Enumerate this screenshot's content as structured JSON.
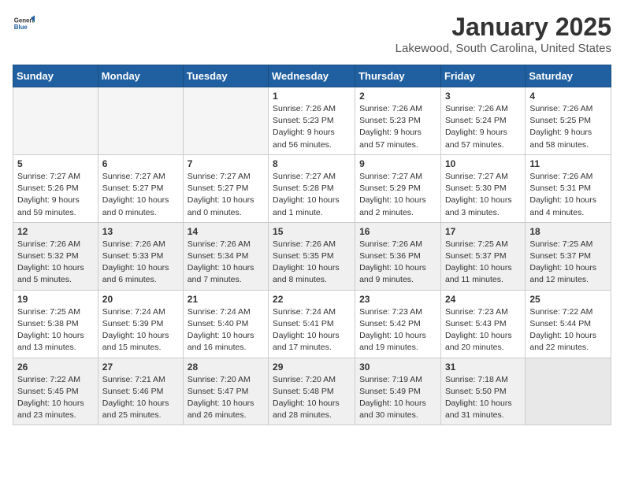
{
  "logo": {
    "general": "General",
    "blue": "Blue"
  },
  "header": {
    "title": "January 2025",
    "subtitle": "Lakewood, South Carolina, United States"
  },
  "weekdays": [
    "Sunday",
    "Monday",
    "Tuesday",
    "Wednesday",
    "Thursday",
    "Friday",
    "Saturday"
  ],
  "weeks": [
    {
      "shaded": false,
      "days": [
        {
          "num": "",
          "info": ""
        },
        {
          "num": "",
          "info": ""
        },
        {
          "num": "",
          "info": ""
        },
        {
          "num": "1",
          "info": "Sunrise: 7:26 AM\nSunset: 5:23 PM\nDaylight: 9 hours\nand 56 minutes."
        },
        {
          "num": "2",
          "info": "Sunrise: 7:26 AM\nSunset: 5:23 PM\nDaylight: 9 hours\nand 57 minutes."
        },
        {
          "num": "3",
          "info": "Sunrise: 7:26 AM\nSunset: 5:24 PM\nDaylight: 9 hours\nand 57 minutes."
        },
        {
          "num": "4",
          "info": "Sunrise: 7:26 AM\nSunset: 5:25 PM\nDaylight: 9 hours\nand 58 minutes."
        }
      ]
    },
    {
      "shaded": false,
      "days": [
        {
          "num": "5",
          "info": "Sunrise: 7:27 AM\nSunset: 5:26 PM\nDaylight: 9 hours\nand 59 minutes."
        },
        {
          "num": "6",
          "info": "Sunrise: 7:27 AM\nSunset: 5:27 PM\nDaylight: 10 hours\nand 0 minutes."
        },
        {
          "num": "7",
          "info": "Sunrise: 7:27 AM\nSunset: 5:27 PM\nDaylight: 10 hours\nand 0 minutes."
        },
        {
          "num": "8",
          "info": "Sunrise: 7:27 AM\nSunset: 5:28 PM\nDaylight: 10 hours\nand 1 minute."
        },
        {
          "num": "9",
          "info": "Sunrise: 7:27 AM\nSunset: 5:29 PM\nDaylight: 10 hours\nand 2 minutes."
        },
        {
          "num": "10",
          "info": "Sunrise: 7:27 AM\nSunset: 5:30 PM\nDaylight: 10 hours\nand 3 minutes."
        },
        {
          "num": "11",
          "info": "Sunrise: 7:26 AM\nSunset: 5:31 PM\nDaylight: 10 hours\nand 4 minutes."
        }
      ]
    },
    {
      "shaded": true,
      "days": [
        {
          "num": "12",
          "info": "Sunrise: 7:26 AM\nSunset: 5:32 PM\nDaylight: 10 hours\nand 5 minutes."
        },
        {
          "num": "13",
          "info": "Sunrise: 7:26 AM\nSunset: 5:33 PM\nDaylight: 10 hours\nand 6 minutes."
        },
        {
          "num": "14",
          "info": "Sunrise: 7:26 AM\nSunset: 5:34 PM\nDaylight: 10 hours\nand 7 minutes."
        },
        {
          "num": "15",
          "info": "Sunrise: 7:26 AM\nSunset: 5:35 PM\nDaylight: 10 hours\nand 8 minutes."
        },
        {
          "num": "16",
          "info": "Sunrise: 7:26 AM\nSunset: 5:36 PM\nDaylight: 10 hours\nand 9 minutes."
        },
        {
          "num": "17",
          "info": "Sunrise: 7:25 AM\nSunset: 5:37 PM\nDaylight: 10 hours\nand 11 minutes."
        },
        {
          "num": "18",
          "info": "Sunrise: 7:25 AM\nSunset: 5:37 PM\nDaylight: 10 hours\nand 12 minutes."
        }
      ]
    },
    {
      "shaded": false,
      "days": [
        {
          "num": "19",
          "info": "Sunrise: 7:25 AM\nSunset: 5:38 PM\nDaylight: 10 hours\nand 13 minutes."
        },
        {
          "num": "20",
          "info": "Sunrise: 7:24 AM\nSunset: 5:39 PM\nDaylight: 10 hours\nand 15 minutes."
        },
        {
          "num": "21",
          "info": "Sunrise: 7:24 AM\nSunset: 5:40 PM\nDaylight: 10 hours\nand 16 minutes."
        },
        {
          "num": "22",
          "info": "Sunrise: 7:24 AM\nSunset: 5:41 PM\nDaylight: 10 hours\nand 17 minutes."
        },
        {
          "num": "23",
          "info": "Sunrise: 7:23 AM\nSunset: 5:42 PM\nDaylight: 10 hours\nand 19 minutes."
        },
        {
          "num": "24",
          "info": "Sunrise: 7:23 AM\nSunset: 5:43 PM\nDaylight: 10 hours\nand 20 minutes."
        },
        {
          "num": "25",
          "info": "Sunrise: 7:22 AM\nSunset: 5:44 PM\nDaylight: 10 hours\nand 22 minutes."
        }
      ]
    },
    {
      "shaded": true,
      "days": [
        {
          "num": "26",
          "info": "Sunrise: 7:22 AM\nSunset: 5:45 PM\nDaylight: 10 hours\nand 23 minutes."
        },
        {
          "num": "27",
          "info": "Sunrise: 7:21 AM\nSunset: 5:46 PM\nDaylight: 10 hours\nand 25 minutes."
        },
        {
          "num": "28",
          "info": "Sunrise: 7:20 AM\nSunset: 5:47 PM\nDaylight: 10 hours\nand 26 minutes."
        },
        {
          "num": "29",
          "info": "Sunrise: 7:20 AM\nSunset: 5:48 PM\nDaylight: 10 hours\nand 28 minutes."
        },
        {
          "num": "30",
          "info": "Sunrise: 7:19 AM\nSunset: 5:49 PM\nDaylight: 10 hours\nand 30 minutes."
        },
        {
          "num": "31",
          "info": "Sunrise: 7:18 AM\nSunset: 5:50 PM\nDaylight: 10 hours\nand 31 minutes."
        },
        {
          "num": "",
          "info": ""
        }
      ]
    }
  ]
}
